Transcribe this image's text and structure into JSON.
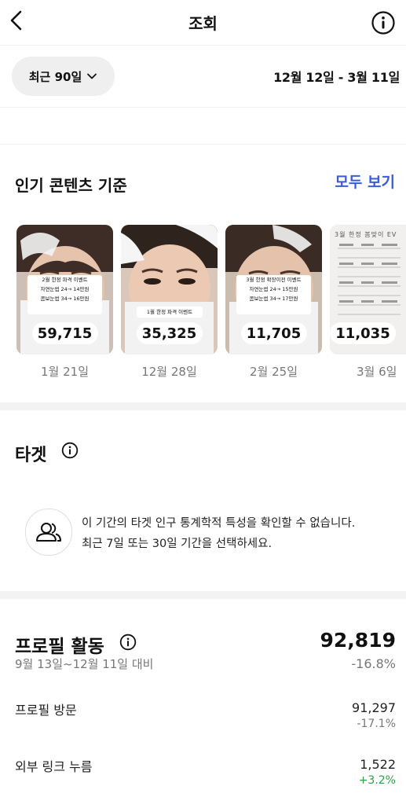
{
  "header": {
    "title": "조회",
    "back_icon": "chevron-left-icon",
    "info_icon": "info-circle-icon"
  },
  "range": {
    "selected": "최근 90일",
    "dates": "12월 12일 - 3월 11일"
  },
  "popular": {
    "title": "인기 콘텐츠 기준",
    "see_all": "모두 보기",
    "items": [
      {
        "count": "59,715",
        "date": "1월 21일",
        "overlay_lines": [
          "2월 한정 파격 이벤트",
          "자연눈썹 24→ 14만원",
          "콤보눈썹 34→ 16만원"
        ]
      },
      {
        "count": "35,325",
        "date": "12월 28일",
        "overlay_lines": [
          "1월 한정 파격 이벤트"
        ]
      },
      {
        "count": "11,705",
        "date": "2월 25일",
        "overlay_lines": [
          "3월 한정 확장이전 이벤트",
          "자연눈썹 24→ 15만원",
          "콤보눈썹 34→ 17만원"
        ]
      },
      {
        "count": "11,035",
        "date": "3월 6일",
        "overlay_lines": [
          "3월 한정 봄맞이 EV"
        ]
      }
    ]
  },
  "target": {
    "title": "타겟",
    "notice": "이 기간의 타겟 인구 통계학적 특성을 확인할 수 없습니다. 최근 7일 또는 30일 기간을 선택하세요."
  },
  "profile_activity": {
    "title": "프로필 활동",
    "compare": "9월 13일~12월 11일 대비",
    "total": "92,819",
    "change": "-16.8%",
    "rows": [
      {
        "label": "프로필 방문",
        "value": "91,297",
        "change": "-17.1%"
      },
      {
        "label": "외부 링크 누름",
        "value": "1,522",
        "change": "+3.2%"
      }
    ]
  },
  "colors": {
    "accent": "#3b5bdb",
    "positive": "#2e9e44",
    "muted": "#777777"
  }
}
